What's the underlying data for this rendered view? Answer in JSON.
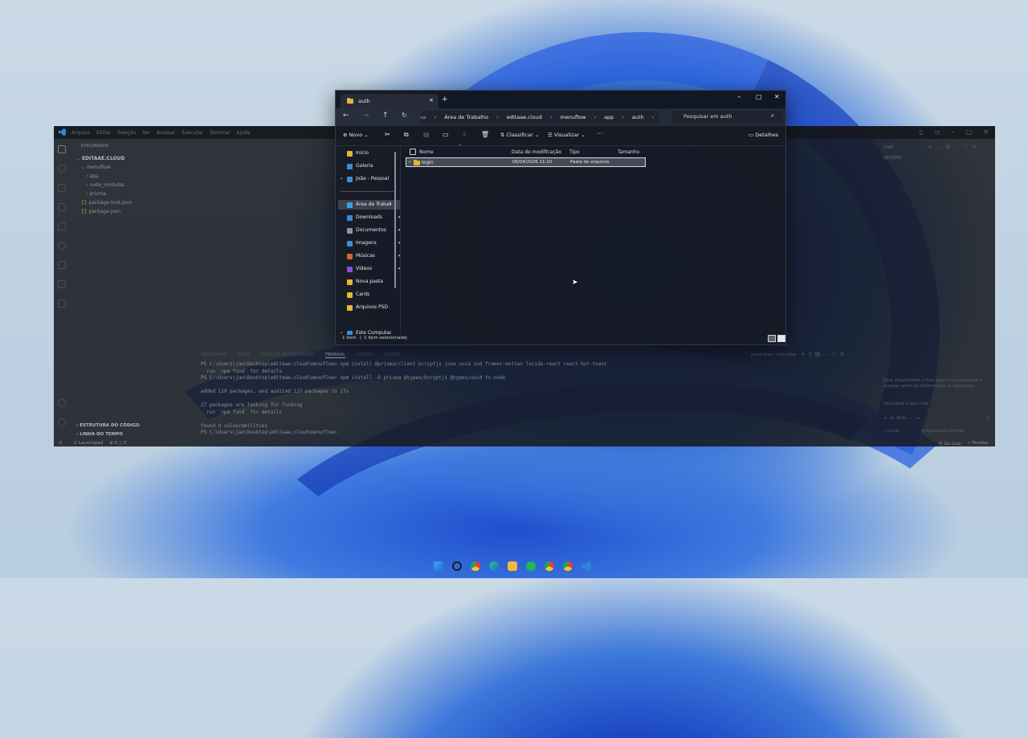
{
  "vscode": {
    "menu": [
      "Arquivo",
      "Editar",
      "Seleção",
      "Ver",
      "Acessar",
      "Executar",
      "Terminal",
      "Ajuda"
    ],
    "explorer_title": "EXPLORADOR",
    "tree": [
      "EDITAAE.CLOUD",
      "menuflow",
      "app",
      "node_modules",
      "prisma",
      "package-lock.json",
      "package.json"
    ],
    "outline": "ESTRUTURA DO CÓDIGO",
    "timeline": "LINHA DO TEMPO",
    "panel_tabs": [
      "PROBLEMAS",
      "SAÍDA",
      "CONSOLE DE DEPURAÇÃO",
      "TERMINAL",
      "PORTAS",
      "GITLENS"
    ],
    "terminal_name": "powershell - menuflow",
    "terminal_lines": [
      "PS C:\\Users\\jao\\Desktop\\editaae.cloud\\menuflow> npm install @prisma/client bcryptjs jose uuid zod framer-motion lucide-react react-hot-toast",
      "  run `npm fund` for details",
      "PS C:\\Users\\jao\\Desktop\\editaae.cloud\\menuflow> npm install -D prisma @types/bcryptjs @types/uuid ts-node",
      "",
      "added 119 packages, and audited 137 packages in 17s",
      "",
      "17 packages are looking for funding",
      "  run `npm fund` for details",
      "",
      "found 0 vulnerabilities",
      "PS C:\\Users\\jao\\Desktop\\editaae.cloud\\menuflow> "
    ],
    "chat": {
      "title": "CHAT",
      "sessions": "SESSÕES",
      "hint": "Dica: Experimente o Plan agent para pesquisar e planejar antes de implementar as alterações.",
      "input_placeholder": "Descreva o que criar",
      "mode": "Auto",
      "local": "Local",
      "approval": "Aprovações Padrão"
    },
    "status": {
      "launchpad": "Launchpad",
      "problems": "⊗ 0 △ 0",
      "go_live": "Go Live",
      "prettier": "Prettier"
    }
  },
  "explorer": {
    "tab_title": "auth",
    "breadcrumbs": [
      "Área de Trabalho",
      "editaae.cloud",
      "menuflow",
      "app",
      "auth"
    ],
    "search_placeholder": "Pesquisar em auth",
    "toolbar": {
      "new": "Novo",
      "sort": "Classificar",
      "view": "Visualizar",
      "more": "···",
      "details": "Detalhes"
    },
    "nav": [
      {
        "label": "Início",
        "icon": "home-icon",
        "color": "#e8b43a"
      },
      {
        "label": "Galeria",
        "icon": "gallery-icon",
        "color": "#3a8fd8"
      },
      {
        "label": "João - Pessoal",
        "icon": "cloud-icon",
        "color": "#3a8fd8"
      },
      {
        "label": "Área de Trabalho",
        "icon": "desktop-icon",
        "color": "#3aa0e0",
        "pinned": true
      },
      {
        "label": "Downloads",
        "icon": "downloads-icon",
        "color": "#2f8be0",
        "pinned": true
      },
      {
        "label": "Documentos",
        "icon": "documents-icon",
        "color": "#8a96a8",
        "pinned": true
      },
      {
        "label": "Imagens",
        "icon": "pictures-icon",
        "color": "#3a8fd8",
        "pinned": true
      },
      {
        "label": "Músicas",
        "icon": "music-icon",
        "color": "#e0603a",
        "pinned": true
      },
      {
        "label": "Vídeos",
        "icon": "videos-icon",
        "color": "#8a4de0",
        "pinned": true
      },
      {
        "label": "Nova pasta",
        "icon": "folder-icon",
        "color": "#e8b43a"
      },
      {
        "label": "Cards",
        "icon": "folder-icon",
        "color": "#e8b43a"
      },
      {
        "label": "Arquivos PSD",
        "icon": "folder-icon",
        "color": "#e8b43a"
      },
      {
        "label": "Este Computador",
        "icon": "computer-icon",
        "color": "#3a8fd8"
      }
    ],
    "columns": {
      "name": "Nome",
      "date": "Data de modificação",
      "type": "Tipo",
      "size": "Tamanho"
    },
    "files": [
      {
        "name": "login",
        "date": "06/04/2026 11:10",
        "type": "Pasta de arquivos",
        "size": ""
      }
    ],
    "status": {
      "count": "1 item",
      "selected": "1 item selecionado"
    }
  }
}
